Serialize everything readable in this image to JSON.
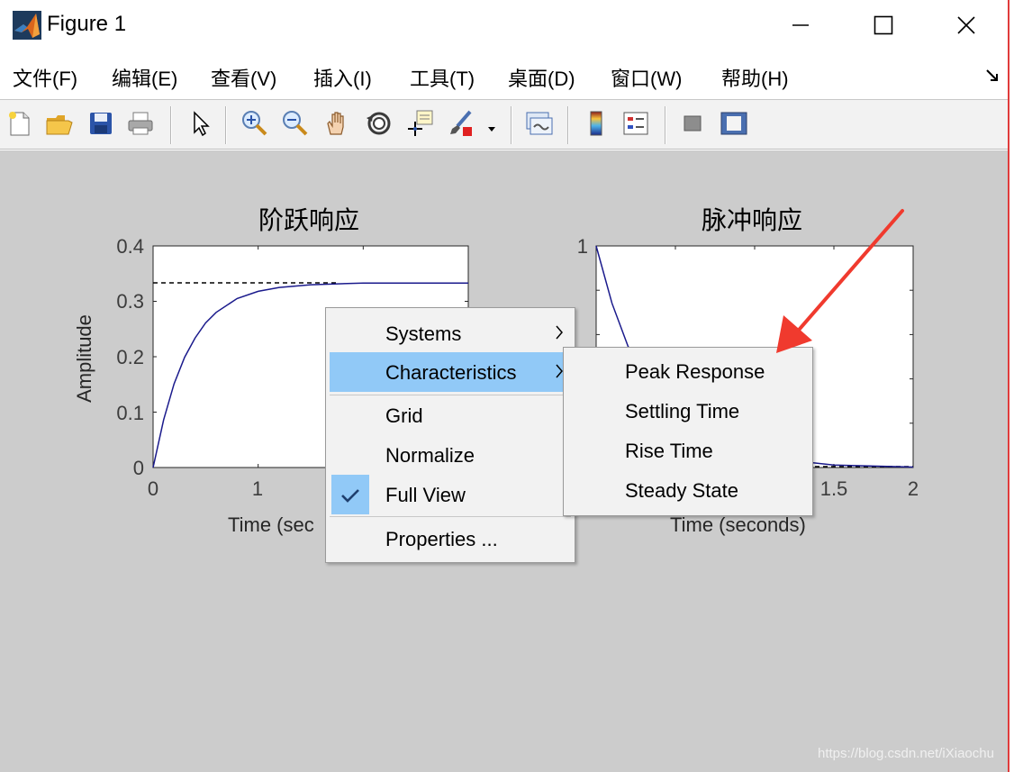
{
  "window": {
    "title": "Figure 1",
    "icon": "matlab-logo-icon",
    "controls": [
      "minimize-icon",
      "maximize-icon",
      "close-icon"
    ]
  },
  "menubar": {
    "items": [
      {
        "label": "文件(F)"
      },
      {
        "label": "编辑(E)"
      },
      {
        "label": "查看(V)"
      },
      {
        "label": "插入(I)"
      },
      {
        "label": "工具(T)"
      },
      {
        "label": "桌面(D)"
      },
      {
        "label": "窗口(W)"
      },
      {
        "label": "帮助(H)"
      }
    ],
    "dock_icon": "dock-arrow-icon"
  },
  "toolbar": {
    "buttons": [
      "new-figure-icon",
      "open-file-icon",
      "save-icon",
      "print-icon",
      "edit-plot-icon",
      "zoom-in-icon",
      "zoom-out-icon",
      "pan-icon",
      "rotate-3d-icon",
      "data-cursor-icon",
      "brush-icon",
      "brush-dropdown-icon",
      "link-plot-icon",
      "insert-colorbar-icon",
      "insert-legend-icon",
      "hide-plot-tools-icon",
      "show-plot-tools-icon"
    ]
  },
  "plots": {
    "step": {
      "title": "阶跃响应",
      "ylabel": "Amplitude",
      "xlabel": "Time (sec",
      "yticks": [
        "0",
        "0.1",
        "0.2",
        "0.3",
        "0.4"
      ],
      "xticks": [
        "0",
        "1"
      ]
    },
    "impulse": {
      "title": "脉冲响应",
      "xlabel": "Time (seconds)",
      "yticks": [
        "1"
      ],
      "xticks": [
        "1.5",
        "2"
      ]
    }
  },
  "chart_data": [
    {
      "type": "line",
      "title": "阶跃响应",
      "xlabel": "Time (seconds)",
      "ylabel": "Amplitude",
      "xlim": [
        0,
        3
      ],
      "ylim": [
        0,
        0.4
      ],
      "series": [
        {
          "x": [
            0,
            0.1,
            0.2,
            0.3,
            0.4,
            0.5,
            0.6,
            0.8,
            1.0,
            1.2,
            1.5,
            2.0,
            2.5,
            3.0
          ],
          "y": [
            0,
            0.086,
            0.151,
            0.199,
            0.234,
            0.261,
            0.28,
            0.305,
            0.318,
            0.325,
            0.33,
            0.333,
            0.333,
            0.333
          ]
        }
      ],
      "reference_lines": [
        {
          "y": 0.333,
          "style": "dashed"
        }
      ],
      "grid": false
    },
    {
      "type": "line",
      "title": "脉冲响应",
      "xlabel": "Time (seconds)",
      "xlim": [
        0,
        2
      ],
      "ylim": [
        0,
        1
      ],
      "series": [
        {
          "x": [
            0,
            0.1,
            0.2,
            0.3,
            0.4,
            0.5,
            0.7,
            1.0,
            1.5,
            2.0
          ],
          "y": [
            1,
            0.741,
            0.549,
            0.407,
            0.301,
            0.223,
            0.122,
            0.05,
            0.011,
            0.002
          ]
        }
      ],
      "reference_lines": [
        {
          "y": 0,
          "style": "dashed"
        }
      ],
      "grid": false
    }
  ],
  "context_menu": {
    "items": [
      {
        "label": "Systems",
        "submenu": true
      },
      {
        "label": "Characteristics",
        "submenu": true,
        "active": true
      },
      {
        "label": "Grid"
      },
      {
        "label": "Normalize"
      },
      {
        "label": "Full View",
        "checked": true
      },
      {
        "label": "Properties ..."
      }
    ],
    "submenu": {
      "items": [
        {
          "label": "Peak Response"
        },
        {
          "label": "Settling Time"
        },
        {
          "label": "Rise Time"
        },
        {
          "label": "Steady State"
        }
      ]
    }
  },
  "colors": {
    "canvas": "#cccccc",
    "menu_highlight": "#91c9f7",
    "plot_line": "#1a1a8c",
    "annotation_arrow": "#f03a2e",
    "window_border": "#e03b3b"
  },
  "watermark": "https://blog.csdn.net/iXiaochu"
}
